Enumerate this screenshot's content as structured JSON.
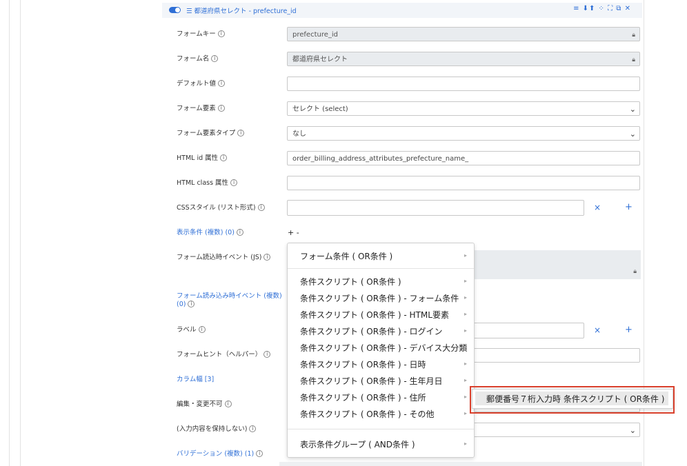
{
  "header": {
    "title": "都道府県セレクト - prefecture_id",
    "tools": "≡ ⬇⬆ ⁘ ⛶ ⧉ ✕"
  },
  "rows": {
    "form_key": {
      "label": "フォームキー",
      "value": "prefecture_id"
    },
    "form_name": {
      "label": "フォーム名",
      "value": "都道府県セレクト"
    },
    "default_value": {
      "label": "デフォルト値",
      "value": ""
    },
    "form_element": {
      "label": "フォーム要素",
      "value": "セレクト (select)"
    },
    "form_element_type": {
      "label": "フォーム要素タイプ",
      "value": "なし"
    },
    "html_id": {
      "label": "HTML id 属性",
      "value": "order_billing_address_attributes_prefecture_name_"
    },
    "html_class": {
      "label": "HTML class 属性",
      "value": ""
    },
    "css_style": {
      "label": "CSSスタイル (リスト形式)",
      "value": ""
    },
    "display_condition": {
      "label": "表示条件 (複数) (0)",
      "toggle": "+ -"
    },
    "form_load_event": {
      "label": "フォーム読込時イベント (JS)"
    },
    "form_load_events": {
      "label_line1": "フォーム読み込み時イベント (複数)",
      "label_line2": "(0)"
    },
    "label": {
      "label": "ラベル"
    },
    "form_hint": {
      "label": "フォームヒント（ヘルパー）"
    },
    "column_width": {
      "label": "カラム幅 [3]"
    },
    "edit_lock": {
      "label": "編集・変更不可"
    },
    "no_keep": {
      "label": "(入力内容を保持しない)"
    },
    "validation": {
      "label": "バリデーション (複数) (1)"
    }
  },
  "icons": {
    "remove": "×",
    "add": "+"
  },
  "menu": {
    "items": [
      "フォーム条件 ( OR条件 )",
      "条件スクリプト ( OR条件 )",
      "条件スクリプト ( OR条件 ) - フォーム条件",
      "条件スクリプト ( OR条件 ) - HTML要素",
      "条件スクリプト ( OR条件 ) - ログイン",
      "条件スクリプト ( OR条件 ) - デバイス大分類",
      "条件スクリプト ( OR条件 ) - 日時",
      "条件スクリプト ( OR条件 ) - 生年月日",
      "条件スクリプト ( OR条件 ) - 住所",
      "条件スクリプト ( OR条件 ) - その他",
      "表示条件グループ ( AND条件 )"
    ],
    "submenu_item": "郵便番号７桁入力時 条件スクリプト ( OR条件 )"
  },
  "colors": {
    "accent": "#2f6fd6",
    "highlight_border": "#d9402c"
  }
}
